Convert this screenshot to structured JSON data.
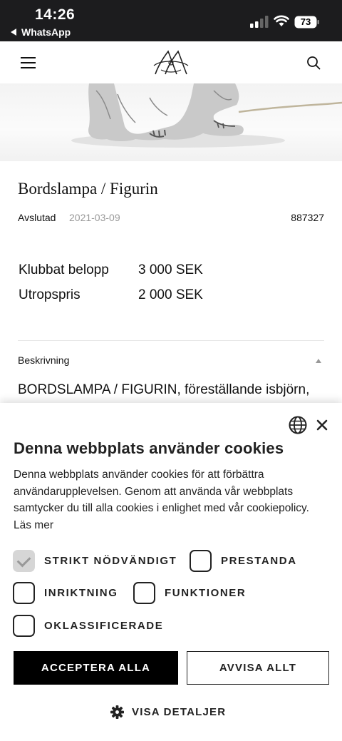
{
  "status_bar": {
    "time": "14:26",
    "back_app": "WhatsApp",
    "battery": "73"
  },
  "header": {
    "menu_icon": "hamburger-menu-icon",
    "logo_icon": "monogram-logo-icon",
    "search_icon": "search-icon"
  },
  "product": {
    "title": "Bordslampa / Figurin",
    "status": "Avslutad",
    "date": "2021-03-09",
    "lot_number": "887327",
    "prices": [
      {
        "label": "Klubbat belopp",
        "value": "3 000 SEK"
      },
      {
        "label": "Utropspris",
        "value": "2 000 SEK"
      }
    ],
    "description_label": "Beskrivning",
    "description_text": "BORDSLAMPA / FIGURIN, föreställande isbjörn,"
  },
  "cookie_banner": {
    "title": "Denna webbplats använder cookies",
    "text": "Denna webbplats använder cookies för att förbättra användarupplevelsen. Genom att använda vår webbplats samtycker du till alla cookies i enlighet med vår cookiepolicy. Läs mer",
    "options": [
      {
        "label": "STRIKT NÖDVÄNDIGT",
        "checked": true
      },
      {
        "label": "PRESTANDA",
        "checked": false
      },
      {
        "label": "INRIKTNING",
        "checked": false
      },
      {
        "label": "FUNKTIONER",
        "checked": false
      },
      {
        "label": "OKLASSIFICERADE",
        "checked": false
      }
    ],
    "accept_label": "ACCEPTERA ALLA",
    "reject_label": "AVVISA ALLT",
    "details_label": "VISA DETALJER"
  }
}
